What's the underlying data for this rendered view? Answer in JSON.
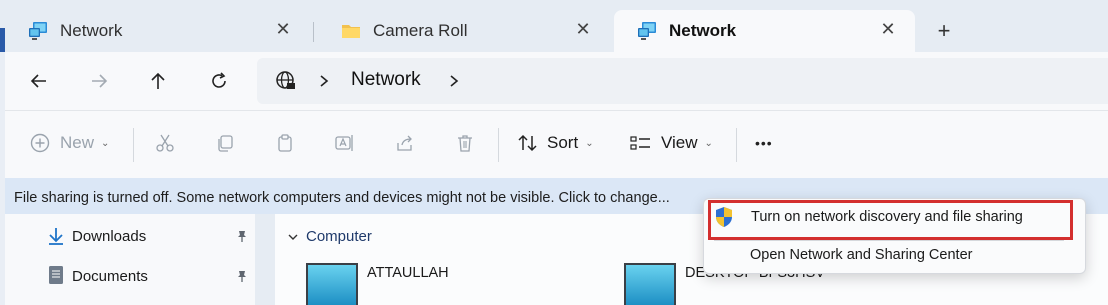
{
  "tabs": [
    {
      "title": "Network",
      "icon": "network-icon",
      "active": false
    },
    {
      "title": "Camera Roll",
      "icon": "folder-icon",
      "active": false
    },
    {
      "title": "Network",
      "icon": "network-icon",
      "active": true
    }
  ],
  "new_tab_symbol": "+",
  "close_symbol": "✕",
  "address": {
    "segments": [
      "Network"
    ]
  },
  "toolbar": {
    "new_label": "New",
    "sort_label": "Sort",
    "view_label": "View",
    "more_label": "•••",
    "caret": "⌄"
  },
  "infobar": {
    "text": "File sharing is turned off. Some network computers and devices might not be visible. Click to change..."
  },
  "nav": {
    "items": [
      {
        "label": "Downloads",
        "icon": "download-icon"
      },
      {
        "label": "Documents",
        "icon": "documents-icon"
      }
    ]
  },
  "content": {
    "group": "Computer",
    "computers": [
      "ATTAULLAH",
      "DESKTOP-BFS3HSV"
    ]
  },
  "context_menu": {
    "items": [
      "Turn on network discovery and file sharing",
      "Open Network and Sharing Center"
    ]
  },
  "colors": {
    "accent": "#2a5aa8",
    "highlight": "#d32f2f",
    "infobar": "#dbe7f6"
  }
}
